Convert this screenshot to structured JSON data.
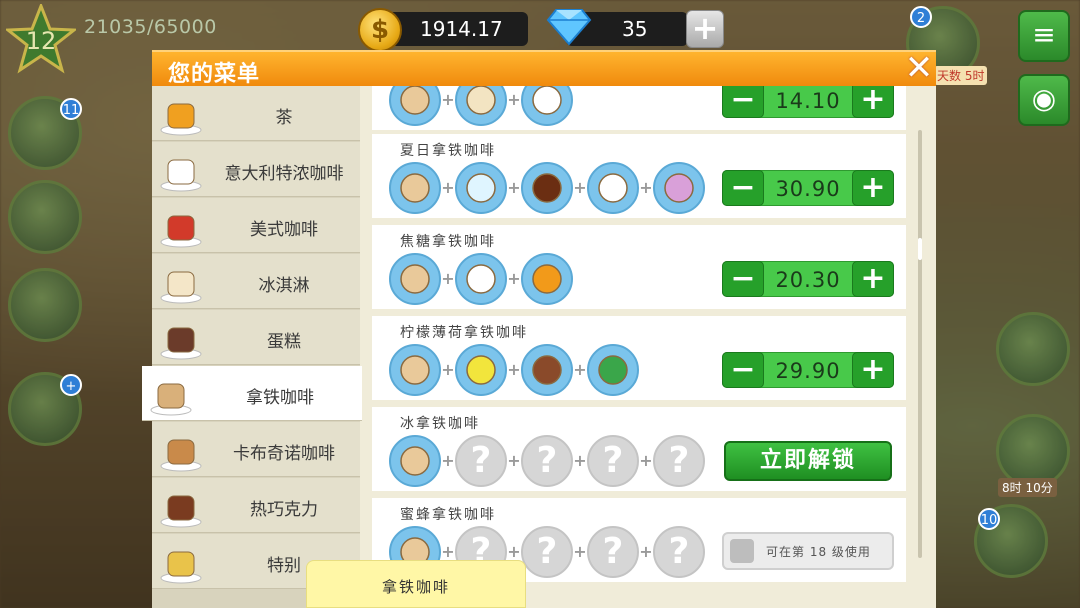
{
  "hud": {
    "level": "12",
    "xp": "21035/65000",
    "coins": "1914.17",
    "gems": "35",
    "gem_plus": "+",
    "side_badges": [
      "11",
      "+",
      "2",
      "10"
    ],
    "right_labels": [
      "天数 5时",
      "8时 10分"
    ]
  },
  "dialog": {
    "title": "您的菜单",
    "close": "✕"
  },
  "categories": [
    {
      "label": "茶",
      "icon": "tea-cup-icon"
    },
    {
      "label": "意大利特浓咖啡",
      "icon": "espresso-icon"
    },
    {
      "label": "美式咖啡",
      "icon": "americano-icon"
    },
    {
      "label": "冰淇淋",
      "icon": "ice-cream-icon"
    },
    {
      "label": "蛋糕",
      "icon": "cake-icon"
    },
    {
      "label": "拿铁咖啡",
      "icon": "latte-icon",
      "active": true
    },
    {
      "label": "卡布奇诺咖啡",
      "icon": "cappuccino-icon"
    },
    {
      "label": "热巧克力",
      "icon": "hot-chocolate-icon"
    },
    {
      "label": "特别",
      "icon": "special-drink-icon"
    }
  ],
  "recipes": [
    {
      "name": "",
      "ingredients": [
        "latte",
        "ice-cream",
        "whipped-cream"
      ],
      "price": "14.10"
    },
    {
      "name": "夏日拿铁咖啡",
      "ingredients": [
        "latte",
        "ice-cubes",
        "chocolate-syrup",
        "whipped-cream",
        "grape-juice"
      ],
      "price": "30.90"
    },
    {
      "name": "焦糖拿铁咖啡",
      "ingredients": [
        "latte",
        "whipped-cream",
        "caramel-syrup"
      ],
      "price": "20.30"
    },
    {
      "name": "柠檬薄荷拿铁咖啡",
      "ingredients": [
        "latte",
        "lemon",
        "chocolate-bar",
        "mint"
      ],
      "price": "29.90"
    },
    {
      "name": "冰拿铁咖啡",
      "ingredients": [
        "latte",
        "?",
        "?",
        "?",
        "?"
      ],
      "action": "立即解锁"
    },
    {
      "name": "蜜蜂拿铁咖啡",
      "ingredients": [
        "latte",
        "?",
        "?",
        "?",
        "?"
      ],
      "lock_text": "可在第 18 级使用"
    }
  ],
  "stepper": {
    "minus": "−",
    "plus": "+"
  },
  "tooltip": "拿铁咖啡",
  "colors": {
    "header": "#f5960f",
    "accent_green": "#2fae32",
    "ingredient_blue": "#7cc4ec"
  }
}
